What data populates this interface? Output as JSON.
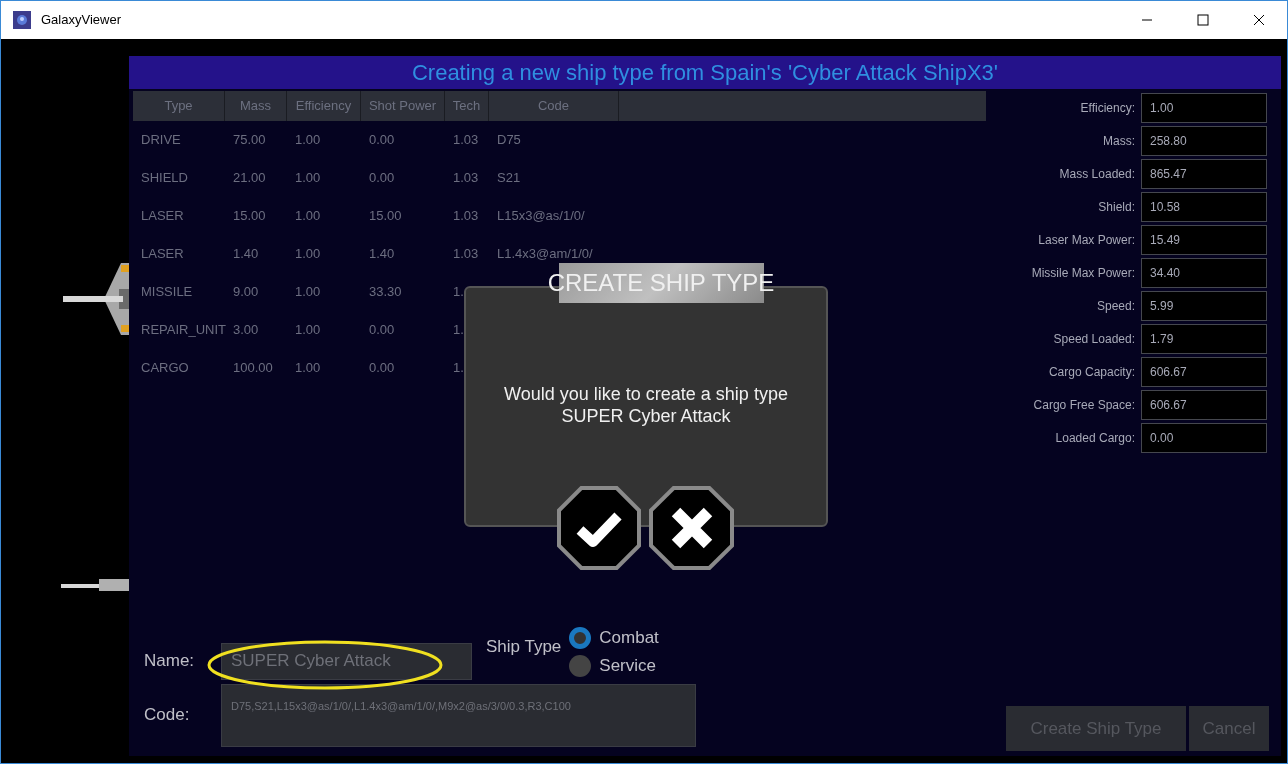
{
  "window": {
    "title": "GalaxyViewer"
  },
  "header": {
    "title": "Creating a new ship type from Spain's 'Cyber Attack ShipX3'"
  },
  "table": {
    "columns": [
      "Type",
      "Mass",
      "Efficiency",
      "Shot Power",
      "Tech",
      "Code"
    ],
    "rows": [
      {
        "cells": [
          "DRIVE",
          "75.00",
          "1.00",
          "0.00",
          "1.03",
          "D75"
        ]
      },
      {
        "cells": [
          "SHIELD",
          "21.00",
          "1.00",
          "0.00",
          "1.03",
          "S21"
        ]
      },
      {
        "cells": [
          "LASER",
          "15.00",
          "1.00",
          "15.00",
          "1.03",
          "L15x3@as/1/0/"
        ]
      },
      {
        "cells": [
          "LASER",
          "1.40",
          "1.00",
          "1.40",
          "1.03",
          "L1.4x3@am/1/0/"
        ]
      },
      {
        "cells": [
          "MISSILE",
          "9.00",
          "1.00",
          "33.30",
          "1."
        ]
      },
      {
        "cells": [
          "REPAIR_UNIT",
          "3.00",
          "1.00",
          "0.00",
          "1."
        ]
      },
      {
        "cells": [
          "CARGO",
          "100.00",
          "1.00",
          "0.00",
          "1."
        ]
      }
    ]
  },
  "stats": [
    {
      "label": "Efficiency:",
      "value": "1.00"
    },
    {
      "label": "Mass:",
      "value": "258.80"
    },
    {
      "label": "Mass Loaded:",
      "value": "865.47"
    },
    {
      "label": "Shield:",
      "value": "10.58"
    },
    {
      "label": "Laser Max Power:",
      "value": "15.49"
    },
    {
      "label": "Missile Max Power:",
      "value": "34.40"
    },
    {
      "label": "Speed:",
      "value": "5.99"
    },
    {
      "label": "Speed Loaded:",
      "value": "1.79"
    },
    {
      "label": "Cargo Capacity:",
      "value": "606.67"
    },
    {
      "label": "Cargo Free Space:",
      "value": "606.67"
    },
    {
      "label": "Loaded Cargo:",
      "value": "0.00"
    }
  ],
  "form": {
    "name_label": "Name:",
    "name_value": "SUPER Cyber Attack",
    "code_label": "Code:",
    "code_value": "D75,S21,L15x3@as/1/0/,L1.4x3@am/1/0/,M9x2@as/3/0/0.3,R3,C100",
    "ship_type_label": "Ship Type",
    "ship_types": [
      {
        "label": "Combat",
        "selected": true
      },
      {
        "label": "Service",
        "selected": false
      }
    ]
  },
  "buttons": [
    {
      "label": "Create Ship Type",
      "disabled": true
    },
    {
      "label": "Cancel",
      "disabled": true
    }
  ],
  "dialog": {
    "title": "CREATE SHIP TYPE",
    "message": "Would you like to create a ship type SUPER Cyber Attack"
  }
}
